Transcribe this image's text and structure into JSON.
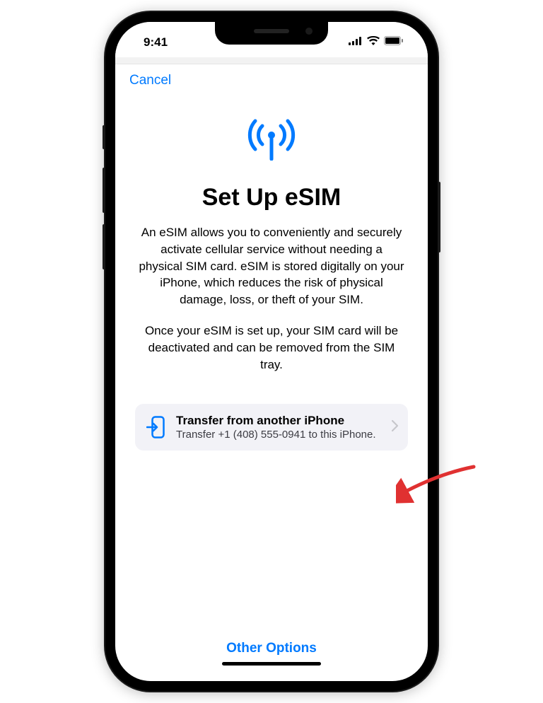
{
  "status_bar": {
    "time": "9:41"
  },
  "nav": {
    "cancel": "Cancel"
  },
  "main": {
    "title": "Set Up eSIM",
    "paragraph1": "An eSIM allows you to conveniently and securely activate cellular service without needing a physical SIM card. eSIM is stored digitally on your iPhone, which reduces the risk of physical damage, loss, or theft of your SIM.",
    "paragraph2": "Once your eSIM is set up, your SIM card will be deactivated and can be removed from the SIM tray."
  },
  "option": {
    "title": "Transfer from another iPhone",
    "subtitle": "Transfer +1 (408) 555-0941 to this iPhone."
  },
  "footer": {
    "other_options": "Other Options"
  }
}
